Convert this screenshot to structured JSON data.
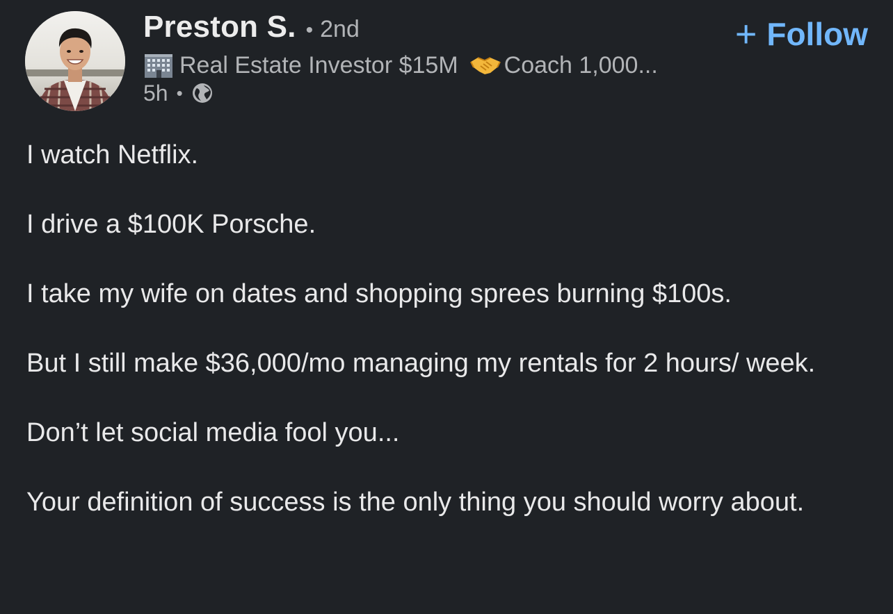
{
  "author": {
    "name": "Preston S.",
    "separator": "•",
    "degree": "2nd",
    "headline_part1": "Real Estate Investor $15M",
    "headline_part2": "Coach 1,000...",
    "headline_icon1": "building-emoji",
    "headline_icon2": "handshake-emoji",
    "time": "5h",
    "time_separator": "•",
    "visibility_icon": "globe-icon"
  },
  "follow_button": {
    "icon": "+",
    "label": "Follow"
  },
  "post": {
    "paragraphs": [
      "I watch Netflix.",
      "I drive a $100K Porsche.",
      "I take my wife on dates and shopping sprees burning $100s.",
      "But I still make $36,000/mo managing my rentals for 2 hours/ week.",
      "Don’t let social media fool you...",
      "Your definition of success is the only thing you should worry about."
    ]
  },
  "colors": {
    "background": "#1f2226",
    "primary_text": "#e9e9ea",
    "secondary_text": "#b2b4b7",
    "accent": "#71b7fb"
  }
}
